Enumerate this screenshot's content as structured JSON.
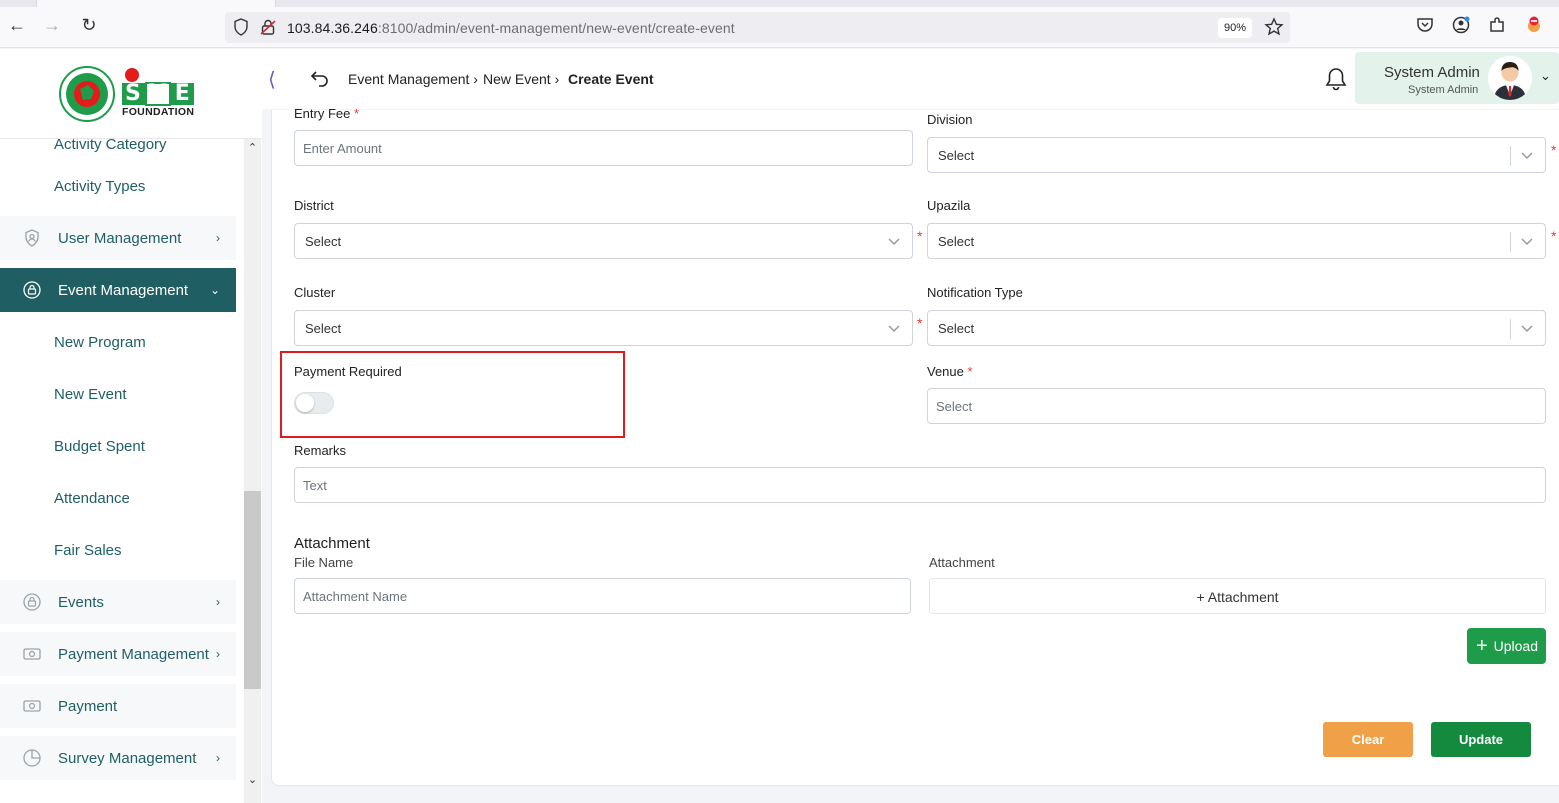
{
  "browser": {
    "url_host": "103.84.36.246",
    "url_rest": ":8100/admin/event-management/new-event/create-event",
    "zoom": "90%"
  },
  "sidebar": {
    "partial_item": "Activity Category",
    "items": [
      {
        "label": "Activity Types"
      },
      {
        "label": "User Management"
      },
      {
        "label": "Event Management"
      },
      {
        "label": "New Program"
      },
      {
        "label": "New Event"
      },
      {
        "label": "Budget Spent"
      },
      {
        "label": "Attendance"
      },
      {
        "label": "Fair Sales"
      },
      {
        "label": "Events"
      },
      {
        "label": "Payment Management"
      },
      {
        "label": "Payment"
      },
      {
        "label": "Survey Management"
      }
    ]
  },
  "logo": {
    "brand": "SME",
    "sub": "FOUNDATION"
  },
  "header": {
    "breadcrumb": [
      "Event Management",
      "New Event",
      "Create Event"
    ],
    "user_name": "System Admin",
    "user_role": "System Admin"
  },
  "form": {
    "entry_fee_label": "Entry Fee",
    "entry_fee_placeholder": "Enter Amount",
    "division_label": "Division",
    "district_label": "District",
    "upazila_label": "Upazila",
    "cluster_label": "Cluster",
    "notification_label": "Notification Type",
    "select_text": "Select",
    "payment_required_label": "Payment Required",
    "payment_required_on": false,
    "venue_label": "Venue",
    "remarks_label": "Remarks",
    "remarks_placeholder": "Text",
    "required_mark": "*"
  },
  "attachment": {
    "section_title": "Attachment",
    "file_name_label": "File Name",
    "file_name_placeholder": "Attachment Name",
    "attachment_label": "Attachment",
    "attachment_button": "+ Attachment",
    "upload_button": "Upload"
  },
  "actions": {
    "clear": "Clear",
    "update": "Update"
  },
  "colors": {
    "primary_teal": "#1f5f63",
    "upload_green": "#1e9c49",
    "update_green": "#138a3e",
    "clear_orange": "#f0a046",
    "highlight_red": "#e31b1b"
  }
}
